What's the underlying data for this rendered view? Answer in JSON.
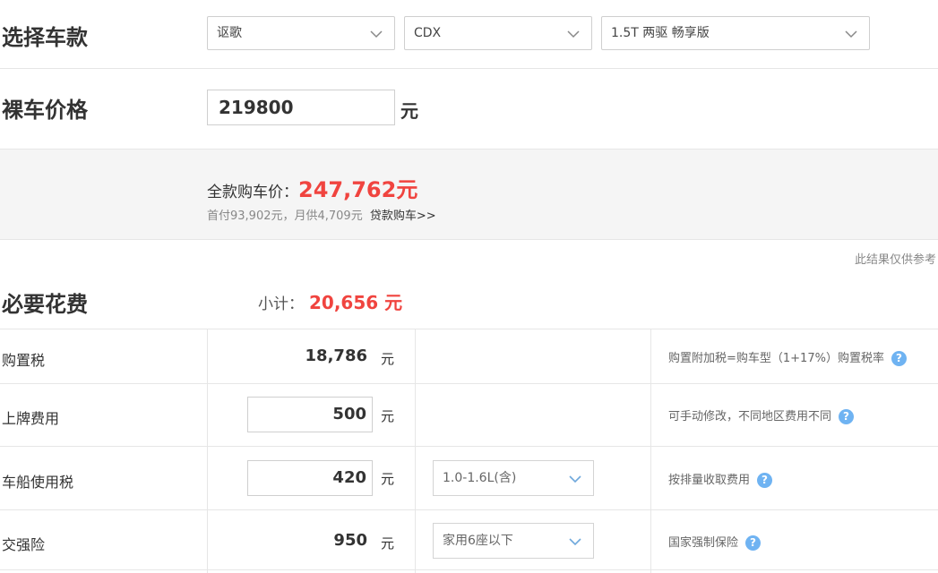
{
  "selectors": {
    "title": "选择车款",
    "brand": "讴歌",
    "model": "CDX",
    "trim": "1.5T 两驱 畅享版"
  },
  "price": {
    "title": "裸车价格",
    "value": "219800",
    "unit": "元"
  },
  "summary": {
    "total_label": "全款购车价：",
    "total_value": "247,762元",
    "loan_text": "首付93,902元，月供4,709元",
    "loan_link": "贷款购车>>",
    "disclaimer": "此结果仅供参考"
  },
  "required": {
    "title": "必要花费",
    "subtotal_label": "小计：",
    "subtotal_value": "20,656 元",
    "rows": [
      {
        "label": "购置税",
        "amount": "18,786",
        "unit": "元",
        "note": "购置附加税=购车型（1+17%）购置税率"
      },
      {
        "label": "上牌费用",
        "amount": "500",
        "unit": "元",
        "note": "可手动修改，不同地区费用不同"
      },
      {
        "label": "车船使用税",
        "amount": "420",
        "unit": "元",
        "select": "1.0-1.6L(含)",
        "note": "按排量收取费用"
      },
      {
        "label": "交强险",
        "amount": "950",
        "unit": "元",
        "select": "家用6座以下",
        "note": "国家强制保险"
      }
    ]
  },
  "help_glyph": "?",
  "colors": {
    "accent_red": "#f0443f",
    "help_blue": "#6fb3f2",
    "panel_bg": "#f5f5f5",
    "border": "#e6e6e6"
  }
}
